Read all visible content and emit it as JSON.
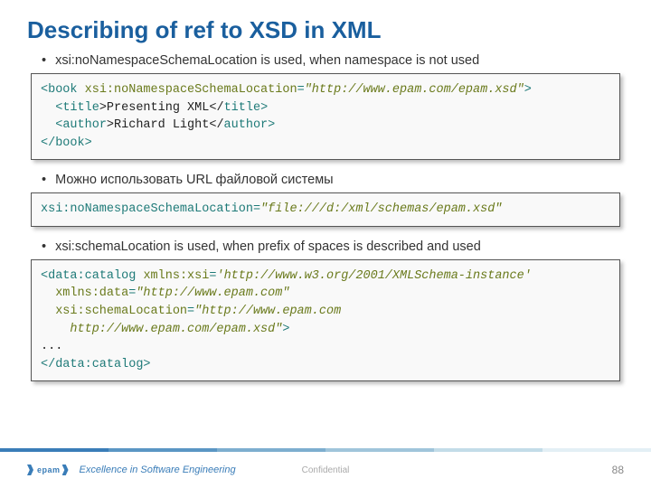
{
  "title": "Describing of ref to XSD in XML",
  "bullets": {
    "b1": "xsi:noNamespaceSchemaLocation is used, when namespace is not used",
    "b2": "Можно использовать URL файловой системы",
    "b3": "xsi:schemaLocation is used, when prefix of spaces is described and used"
  },
  "code1": {
    "l1a": "<",
    "l1b": "book ",
    "l1c": "xsi:noNamespaceSchemaLocation",
    "l1d": "=",
    "l1e": "\"http://www.epam.com/epam.xsd\"",
    "l1f": ">",
    "l2a": "  <",
    "l2b": "title",
    "l2c": ">Presenting XML</",
    "l2d": "title",
    "l2e": ">",
    "l3a": "  <",
    "l3b": "author",
    "l3c": ">Richard Light</",
    "l3d": "author",
    "l3e": ">",
    "l4a": "</",
    "l4b": "book",
    "l4c": ">"
  },
  "code2": {
    "a": "xsi:noNamespaceSchemaLocation",
    "b": "=",
    "c": "\"file:///d:/xml/schemas/epam.xsd\""
  },
  "code3": {
    "l1a": "<",
    "l1b": "data:catalog ",
    "l1c": "xmlns:xsi",
    "l1d": "=",
    "l1e": "'http://www.w3.org/2001/XMLSchema-instance'",
    "l2a": "  xmlns:data",
    "l2b": "=",
    "l2c": "\"http://www.epam.com\"",
    "l3a": "  xsi:schemaLocation",
    "l3b": "=",
    "l3c": "\"http://www.epam.com",
    "l4a": "    http://www.epam.com/epam.xsd\"",
    "l4b": ">",
    "l5": "...",
    "l6a": "</",
    "l6b": "data:catalog",
    "l6c": ">"
  },
  "footer": {
    "logo_text": "epam",
    "tagline": "Excellence in Software Engineering",
    "confidential": "Confidential",
    "page": "88"
  }
}
